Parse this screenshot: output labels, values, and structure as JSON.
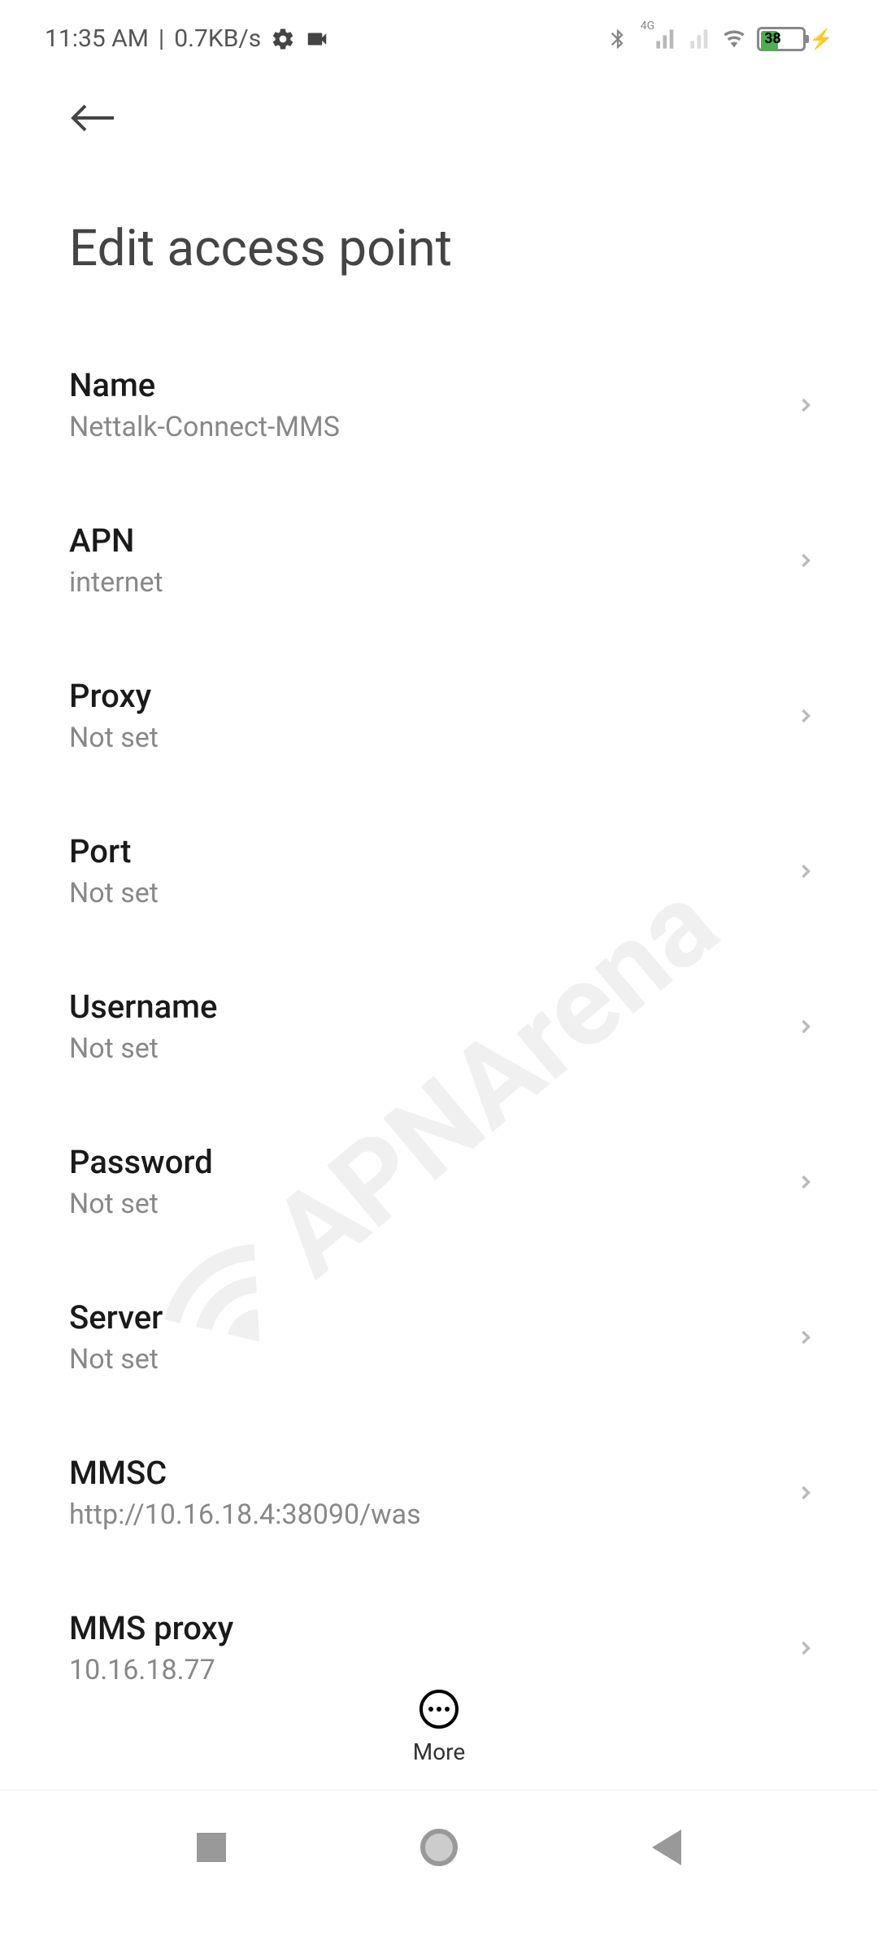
{
  "status_bar": {
    "time": "11:35 AM",
    "data_speed": "0.7KB/s",
    "signal_label": "4G",
    "battery_percent": "38"
  },
  "page": {
    "title": "Edit access point"
  },
  "settings": [
    {
      "label": "Name",
      "value": "Nettalk-Connect-MMS"
    },
    {
      "label": "APN",
      "value": "internet"
    },
    {
      "label": "Proxy",
      "value": "Not set"
    },
    {
      "label": "Port",
      "value": "Not set"
    },
    {
      "label": "Username",
      "value": "Not set"
    },
    {
      "label": "Password",
      "value": "Not set"
    },
    {
      "label": "Server",
      "value": "Not set"
    },
    {
      "label": "MMSC",
      "value": "http://10.16.18.4:38090/was"
    },
    {
      "label": "MMS proxy",
      "value": "10.16.18.77"
    }
  ],
  "bottom": {
    "more_label": "More"
  },
  "watermark": {
    "text": "APNArena"
  }
}
